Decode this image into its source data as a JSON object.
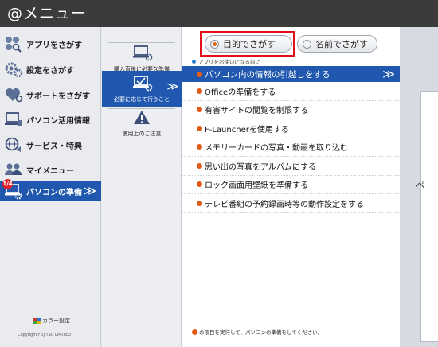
{
  "app": {
    "title": "@メニュー"
  },
  "sidebar": {
    "items": [
      {
        "label": "アプリをさがす",
        "icon": "apps-icon"
      },
      {
        "label": "設定をさがす",
        "icon": "gears-icon"
      },
      {
        "label": "サポートをさがす",
        "icon": "heart-support-icon"
      },
      {
        "label": "パソコン活用情報",
        "icon": "pc-icon"
      },
      {
        "label": "サービス・特典",
        "icon": "globe-service-icon"
      },
      {
        "label": "マイメニュー",
        "icon": "people-icon"
      },
      {
        "label": "パソコンの準備",
        "icon": "pc-gear-icon",
        "badge": "1/4",
        "active": true
      }
    ],
    "color_setting": "カラー設定",
    "copyright": "Copyright FUJITSU LIMITED"
  },
  "subnav": {
    "items": [
      {
        "label": "購入直後に必要な準備",
        "icon": "pc-setup-icon"
      },
      {
        "label": "必要に応じて行うこと",
        "icon": "pc-check-icon",
        "active": true
      },
      {
        "label": "使用上のご注意",
        "icon": "warning-icon"
      }
    ]
  },
  "main": {
    "toggle": {
      "purpose_label": "目的でさがす",
      "name_label": "名前でさがす",
      "selected": "purpose"
    },
    "hint": "アプリをお使いになる前に",
    "rows": [
      {
        "label": "パソコン内の情報の引越しをする",
        "active": true
      },
      {
        "label": "Officeの準備をする"
      },
      {
        "label": "有害サイトの閲覧を制限する"
      },
      {
        "label": "F-Launcherを使用する"
      },
      {
        "label": "メモリーカードの写真・動画を取り込む"
      },
      {
        "label": "思い出の写真をアルバムにする"
      },
      {
        "label": "ロック画面用壁紙を準備する"
      },
      {
        "label": "テレビ番組の予約録画時等の動作設定をする"
      }
    ],
    "footnote": "の項目を実行して、パソコンの準備をしてください。"
  },
  "preview": {
    "glyph": "ペ"
  },
  "colors": {
    "accent": "#1f58ae",
    "titlebar": "#3b3b3b",
    "highlight": "#e0111a",
    "bullet": "#e35a14"
  }
}
